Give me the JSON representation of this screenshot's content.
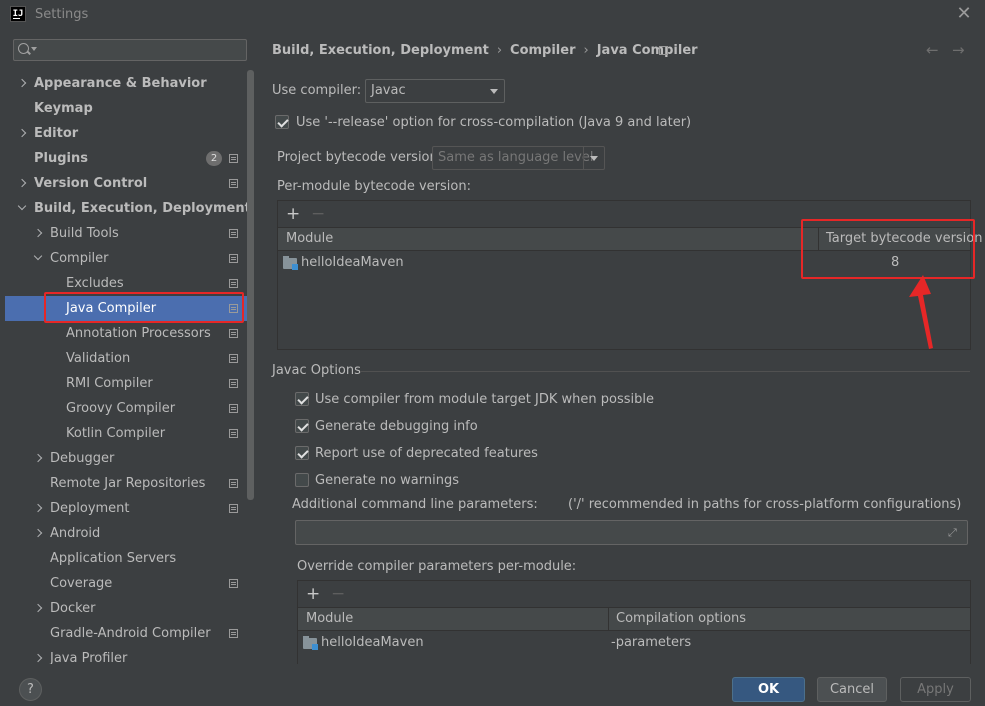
{
  "window": {
    "title": "Settings"
  },
  "search": {
    "placeholder": ""
  },
  "sidebar": {
    "items": [
      {
        "label": "Appearance & Behavior",
        "badge": "",
        "project": false
      },
      {
        "label": "Keymap",
        "badge": "",
        "project": false
      },
      {
        "label": "Editor",
        "badge": "",
        "project": false
      },
      {
        "label": "Plugins",
        "badge": "2",
        "project": true
      },
      {
        "label": "Version Control",
        "badge": "",
        "project": true
      },
      {
        "label": "Build, Execution, Deployment",
        "badge": "",
        "project": false
      },
      {
        "label": "Build Tools",
        "badge": "",
        "project": true
      },
      {
        "label": "Compiler",
        "badge": "",
        "project": true
      },
      {
        "label": "Excludes",
        "badge": "",
        "project": true
      },
      {
        "label": "Java Compiler",
        "badge": "",
        "project": true,
        "selected": true
      },
      {
        "label": "Annotation Processors",
        "badge": "",
        "project": true
      },
      {
        "label": "Validation",
        "badge": "",
        "project": true
      },
      {
        "label": "RMI Compiler",
        "badge": "",
        "project": true
      },
      {
        "label": "Groovy Compiler",
        "badge": "",
        "project": true
      },
      {
        "label": "Kotlin Compiler",
        "badge": "",
        "project": true
      },
      {
        "label": "Debugger",
        "badge": "",
        "project": false
      },
      {
        "label": "Remote Jar Repositories",
        "badge": "",
        "project": true
      },
      {
        "label": "Deployment",
        "badge": "",
        "project": true
      },
      {
        "label": "Android",
        "badge": "",
        "project": false
      },
      {
        "label": "Application Servers",
        "badge": "",
        "project": false
      },
      {
        "label": "Coverage",
        "badge": "",
        "project": true
      },
      {
        "label": "Docker",
        "badge": "",
        "project": false
      },
      {
        "label": "Gradle-Android Compiler",
        "badge": "",
        "project": true
      },
      {
        "label": "Java Profiler",
        "badge": "",
        "project": false
      }
    ]
  },
  "breadcrumb": {
    "items": [
      "Build, Execution, Deployment",
      "Compiler",
      "Java Compiler"
    ],
    "separator": "›"
  },
  "compiler": {
    "use_compiler_label": "Use compiler:",
    "use_compiler_value": "Javac",
    "release_option_label": "Use '--release' option for cross-compilation (Java 9 and later)",
    "release_option_checked": true,
    "project_bytecode_label": "Project bytecode version:",
    "project_bytecode_value": "Same as language level",
    "per_module_label": "Per-module bytecode version:",
    "module_table": {
      "columns": [
        "Module",
        "Target bytecode version"
      ],
      "rows": [
        {
          "module": "helloIdeaMaven",
          "target": "8"
        }
      ]
    }
  },
  "javac_options": {
    "title": "Javac Options",
    "checkboxes": [
      {
        "label": "Use compiler from module target JDK when possible",
        "checked": true
      },
      {
        "label": "Generate debugging info",
        "checked": true
      },
      {
        "label": "Report use of deprecated features",
        "checked": true
      },
      {
        "label": "Generate no warnings",
        "checked": false
      }
    ],
    "additional_params_label": "Additional command line parameters:",
    "additional_params_hint": "('/' recommended in paths for cross-platform configurations)",
    "additional_params_value": "",
    "override_label": "Override compiler parameters per-module:",
    "override_table": {
      "columns": [
        "Module",
        "Compilation options"
      ],
      "rows": [
        {
          "module": "helloIdeaMaven",
          "options": "-parameters"
        }
      ]
    }
  },
  "toolbar": {
    "add": "+",
    "remove": "−"
  },
  "footer": {
    "help": "?",
    "ok": "OK",
    "cancel": "Cancel",
    "apply": "Apply"
  },
  "colors": {
    "selection": "#4b6eaf",
    "highlight": "#e62727",
    "ok_button": "#365880"
  }
}
